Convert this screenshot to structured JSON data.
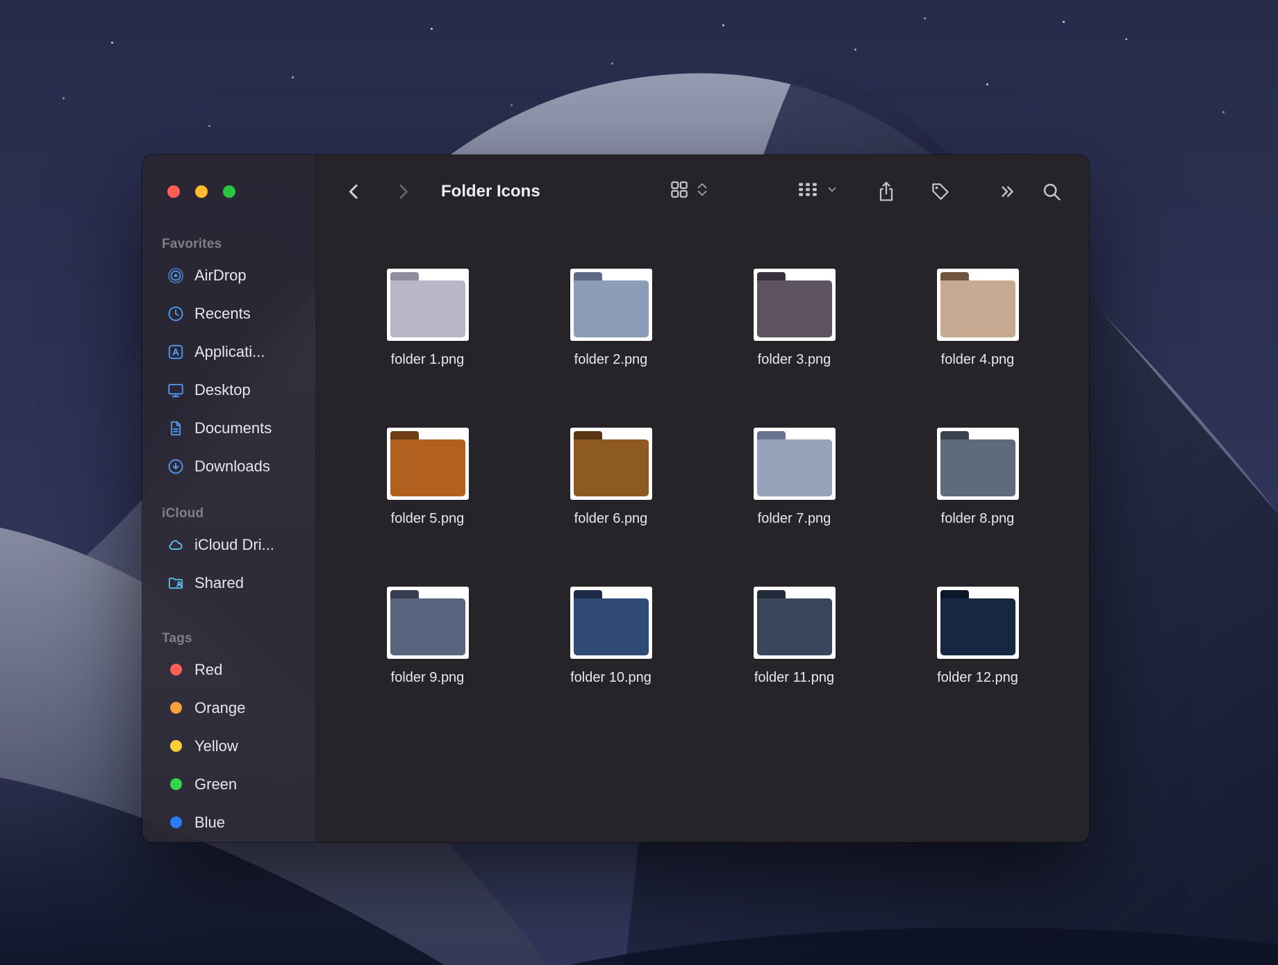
{
  "wallpaper": {
    "name": "macos-mojave-night-dunes"
  },
  "window": {
    "controls": [
      {
        "name": "close",
        "color": "#FF5F57"
      },
      {
        "name": "minimize",
        "color": "#FEBC2E"
      },
      {
        "name": "zoom",
        "color": "#29C73F"
      }
    ]
  },
  "toolbar": {
    "title": "Folder Icons",
    "icons": [
      "back",
      "forward",
      "icon-view",
      "view-switch",
      "group-by",
      "share",
      "tag",
      "more",
      "search"
    ]
  },
  "sidebar": {
    "sections": [
      {
        "header": "Favorites",
        "items": [
          {
            "label": "AirDrop",
            "icon": "airdrop"
          },
          {
            "label": "Recents",
            "icon": "recents-clock"
          },
          {
            "label": "Applicati...",
            "icon": "applications"
          },
          {
            "label": "Desktop",
            "icon": "desktop"
          },
          {
            "label": "Documents",
            "icon": "documents"
          },
          {
            "label": "Downloads",
            "icon": "downloads"
          }
        ]
      },
      {
        "header": "iCloud",
        "items": [
          {
            "label": "iCloud Dri...",
            "icon": "icloud-drive"
          },
          {
            "label": "Shared",
            "icon": "shared-folder"
          }
        ]
      },
      {
        "header": "Tags",
        "items": [
          {
            "label": "Red",
            "color": "#FF6159"
          },
          {
            "label": "Orange",
            "color": "#F7A33C"
          },
          {
            "label": "Yellow",
            "color": "#F8CE3A"
          },
          {
            "label": "Green",
            "color": "#32D74B"
          },
          {
            "label": "Blue",
            "color": "#2C7BF6"
          }
        ]
      }
    ]
  },
  "files": [
    {
      "name": "folder 1.png",
      "body": "#B7B7C6",
      "tab": "#8E8E9F"
    },
    {
      "name": "folder 2.png",
      "body": "#8D9CB8",
      "tab": "#5E6A84"
    },
    {
      "name": "folder 3.png",
      "body": "#5E5461",
      "tab": "#38313D"
    },
    {
      "name": "folder 4.png",
      "body": "#C8AA93",
      "tab": "#70543E"
    },
    {
      "name": "folder 5.png",
      "body": "#B2601F",
      "tab": "#6E3F15"
    },
    {
      "name": "folder 6.png",
      "body": "#8E5A24",
      "tab": "#593512"
    },
    {
      "name": "folder 7.png",
      "body": "#97A3BA",
      "tab": "#68748F"
    },
    {
      "name": "folder 8.png",
      "body": "#5D6B7D",
      "tab": "#39424F"
    },
    {
      "name": "folder 9.png",
      "body": "#59647E",
      "tab": "#363E50"
    },
    {
      "name": "folder 10.png",
      "body": "#2F4A73",
      "tab": "#1C2C49"
    },
    {
      "name": "folder 11.png",
      "body": "#39455A",
      "tab": "#222B39"
    },
    {
      "name": "folder 12.png",
      "body": "#182741",
      "tab": "#0C1729"
    }
  ]
}
